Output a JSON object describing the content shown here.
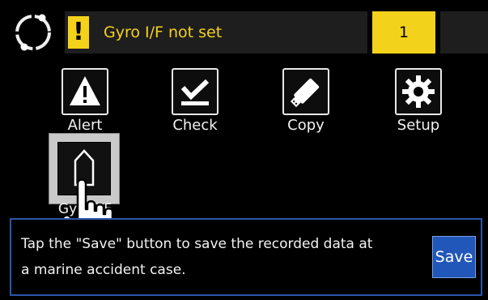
{
  "status": {
    "alarm_text": "Gyro I/F not set",
    "alarm_mark": "!",
    "count": "1"
  },
  "menu": {
    "items": [
      {
        "label": "Alert",
        "icon": "warning-icon"
      },
      {
        "label": "Check",
        "icon": "checkmark-icon"
      },
      {
        "label": "Copy",
        "icon": "usb-stick-icon"
      },
      {
        "label": "Setup",
        "icon": "gear-icon"
      }
    ],
    "gyro": {
      "label": "Gyro I/F",
      "icon": "gyro-heading-icon"
    }
  },
  "message": {
    "line1": "Tap the \"Save\" button to save the recorded data at",
    "line2": "a marine accident case.",
    "save_label": "Save"
  },
  "colors": {
    "alarm_yellow": "#f5d21a",
    "save_blue": "#2157b8",
    "panel_border": "#2a56a8"
  }
}
